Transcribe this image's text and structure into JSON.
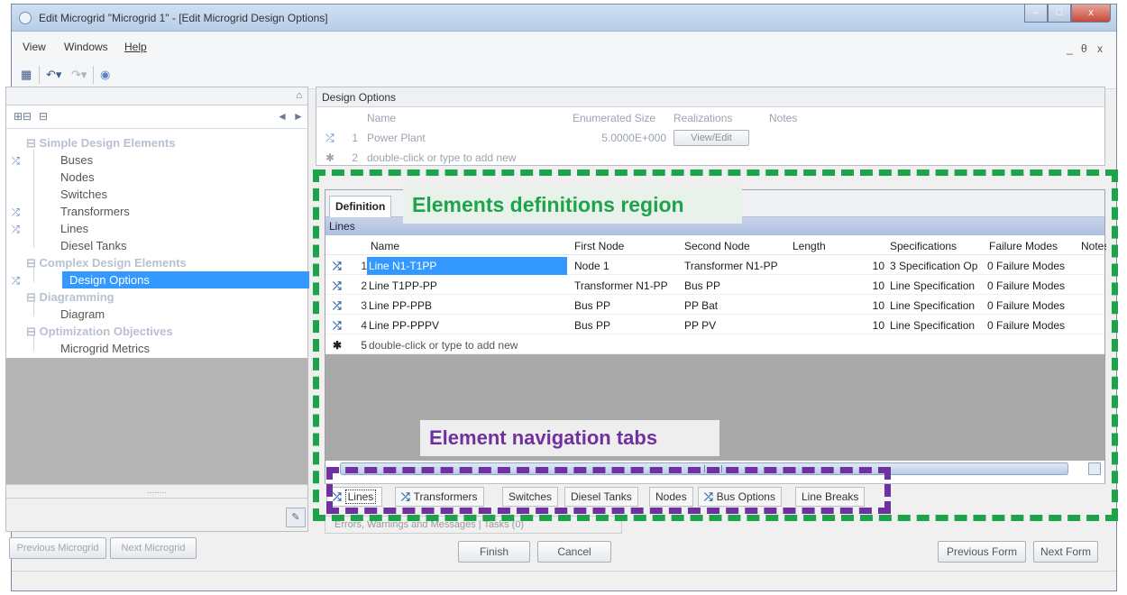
{
  "window": {
    "title": "Edit Microgrid \"Microgrid 1\" - [Edit Microgrid Design Options]",
    "controls": {
      "minimize": "–",
      "maximize": "□",
      "close": "x"
    }
  },
  "menu": {
    "items": [
      "View",
      "Windows",
      "Help"
    ],
    "mdi_controls": [
      "_",
      "θ",
      "x"
    ]
  },
  "toolbar": {
    "icons": [
      "save-icon",
      "undo-icon",
      "redo-icon",
      "help-icon"
    ]
  },
  "left_panel": {
    "pin": "⌂",
    "nav_arrows": [
      "◄",
      "►"
    ],
    "tree": [
      {
        "type": "group",
        "label": "⊟ Simple Design Elements"
      },
      {
        "type": "leaf",
        "label": "Buses",
        "icon": true
      },
      {
        "type": "leaf",
        "label": "Nodes"
      },
      {
        "type": "leaf",
        "label": "Switches"
      },
      {
        "type": "leaf",
        "label": "Transformers",
        "icon": true
      },
      {
        "type": "leaf",
        "label": "Lines",
        "icon": true
      },
      {
        "type": "leaf",
        "label": "Diesel Tanks"
      },
      {
        "type": "group",
        "label": "⊟ Complex Design Elements"
      },
      {
        "type": "leaf",
        "label": "Design Options",
        "icon": true,
        "selected": true
      },
      {
        "type": "group",
        "label": "⊟ Diagramming"
      },
      {
        "type": "leaf",
        "label": "Diagram"
      },
      {
        "type": "group",
        "label": "⊟ Optimization Objectives"
      },
      {
        "type": "leaf",
        "label": "Microgrid Metrics"
      }
    ],
    "splitter_dots": "........"
  },
  "design_options": {
    "title": "Design Options",
    "columns": [
      "Name",
      "Enumerated Size",
      "Realizations",
      "Notes"
    ],
    "rows": [
      {
        "num": "1",
        "name": "Power Plant",
        "size": "5.0000E+000",
        "button": "View/Edit"
      },
      {
        "num": "2",
        "name": "double-click or type to add new"
      }
    ]
  },
  "definition": {
    "tab": "Definition",
    "band": "Lines",
    "columns": [
      "Name",
      "First Node",
      "Second Node",
      "Length",
      "Specifications",
      "Failure Modes",
      "Notes"
    ],
    "rows": [
      {
        "num": "1",
        "name": "Line N1-T1PP",
        "first": "Node 1",
        "second": "Transformer N1-PP",
        "length": "10",
        "spec": "3 Specification Op",
        "failure": "0 Failure Modes"
      },
      {
        "num": "2",
        "name": "Line T1PP-PP",
        "first": "Transformer N1-PP",
        "second": "Bus PP",
        "length": "10",
        "spec": "Line Specification",
        "failure": "0 Failure Modes"
      },
      {
        "num": "3",
        "name": "Line PP-PPB",
        "first": "Bus PP",
        "second": "PP Bat",
        "length": "10",
        "spec": "Line Specification",
        "failure": "0 Failure Modes"
      },
      {
        "num": "4",
        "name": "Line PP-PPPV",
        "first": "Bus PP",
        "second": "PP PV",
        "length": "10",
        "spec": "Line Specification",
        "failure": "0 Failure Modes"
      },
      {
        "num": "5",
        "name": "double-click or type to add new"
      }
    ]
  },
  "nav_tabs": [
    {
      "label": "Lines",
      "icon": true,
      "active": true
    },
    {
      "label": "Transformers",
      "icon": true
    },
    {
      "label": "Switches"
    },
    {
      "label": "Diesel Tanks"
    },
    {
      "label": "Nodes"
    },
    {
      "label": "Bus Options",
      "icon": true
    },
    {
      "label": "Line Breaks"
    }
  ],
  "status_strip": "Errors, Warnings and Messages    |    Tasks (0)",
  "buttons": {
    "previous_microgrid": "Previous Microgrid",
    "next_microgrid": "Next Microgrid",
    "finish": "Finish",
    "cancel": "Cancel",
    "previous_form": "Previous Form",
    "next_form": "Next Form"
  },
  "annotations": {
    "definitions_region": "Elements definitions region",
    "navigation_tabs": "Element navigation tabs"
  },
  "colors": {
    "annotation_green": "#1da34a",
    "annotation_purple": "#7030a0",
    "selection": "#3399ff"
  }
}
